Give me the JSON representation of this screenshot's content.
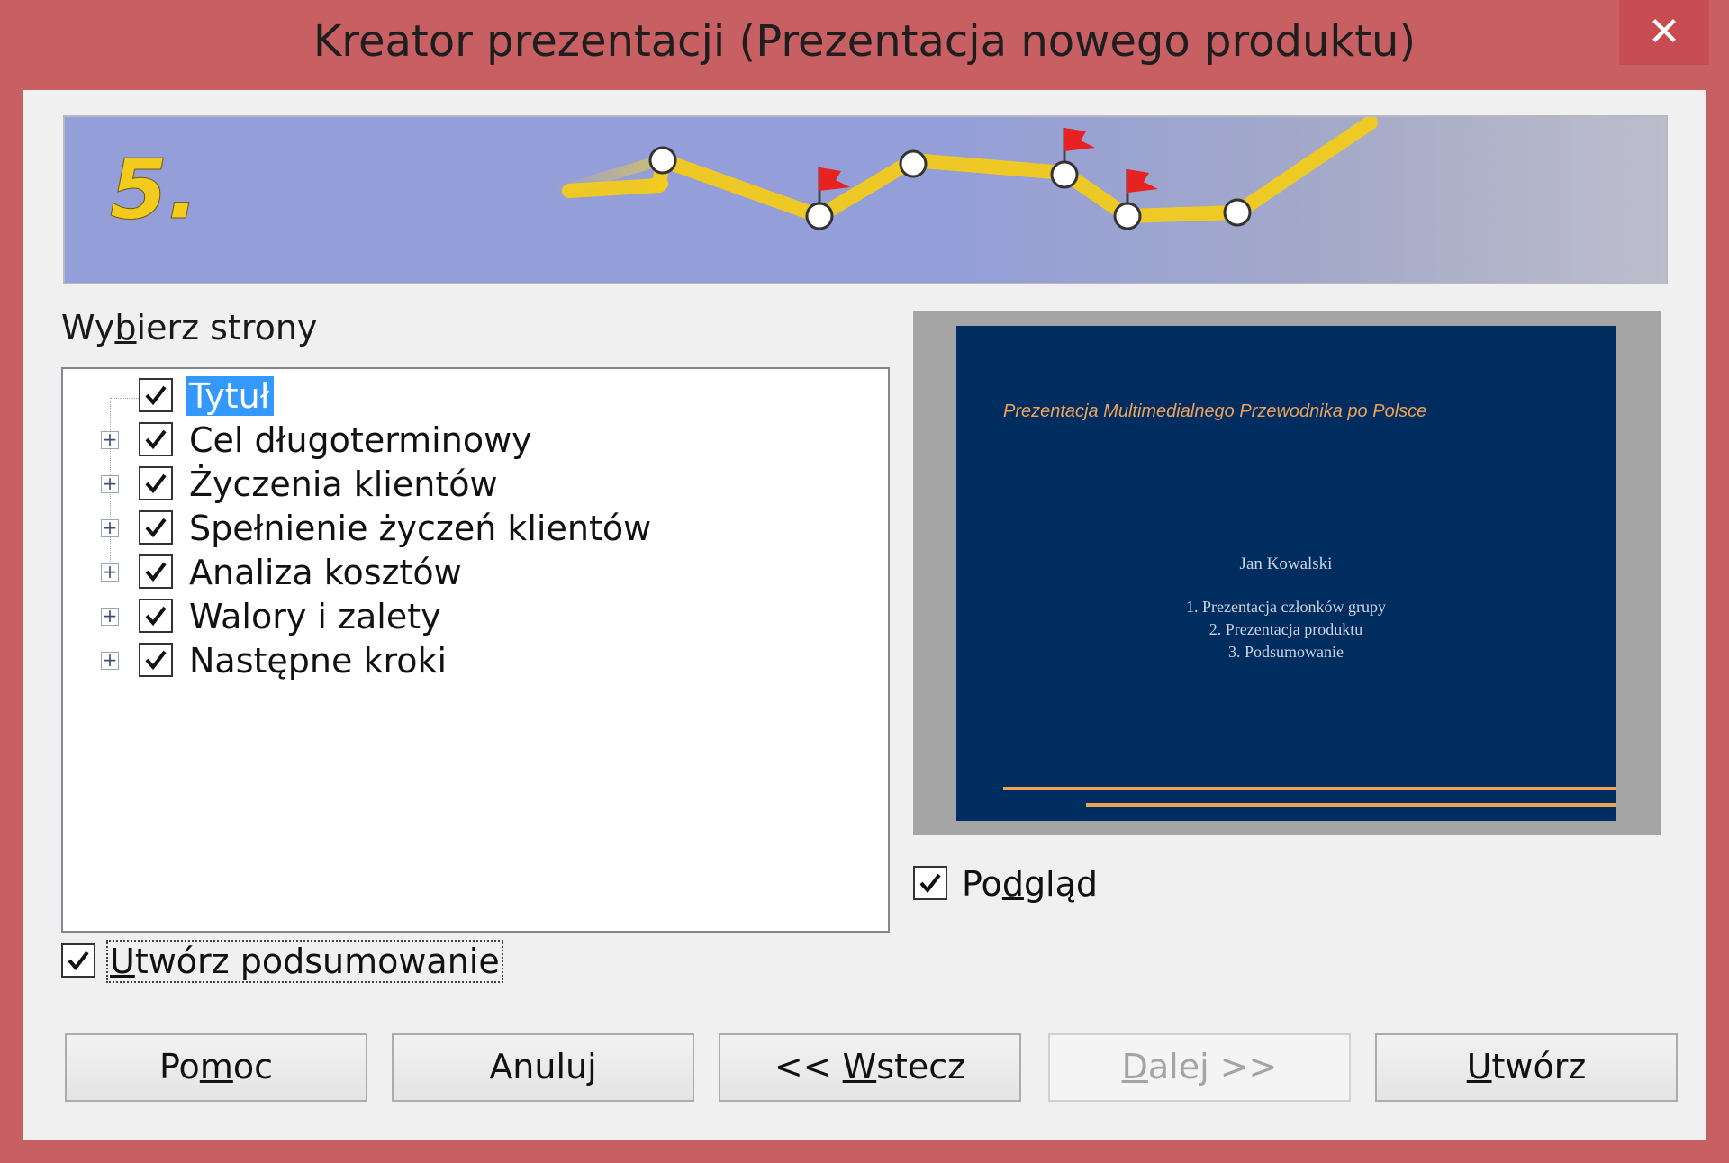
{
  "window": {
    "title": "Kreator prezentacji (Prezentacja nowego produktu)",
    "close_glyph": "✕"
  },
  "banner": {
    "step": "5."
  },
  "pages": {
    "label_pre": "Wy",
    "label_access": "b",
    "label_post": "ierz strony",
    "items": [
      {
        "label": "Tytuł",
        "checked": true,
        "expandable": false,
        "selected": true
      },
      {
        "label": "Cel długoterminowy",
        "checked": true,
        "expandable": true
      },
      {
        "label": "Życzenia klientów",
        "checked": true,
        "expandable": true
      },
      {
        "label": "Spełnienie życzeń klientów",
        "checked": true,
        "expandable": true
      },
      {
        "label": "Analiza kosztów",
        "checked": true,
        "expandable": true
      },
      {
        "label": "Walory i zalety",
        "checked": true,
        "expandable": true
      },
      {
        "label": "Następne kroki",
        "checked": true,
        "expandable": true
      }
    ]
  },
  "preview": {
    "slide_title": "Prezentacja Multimedialnego Przewodnika po Polsce",
    "author": "Jan Kowalski",
    "items": [
      "1. Prezentacja członków grupy",
      "2. Prezentacja produktu",
      "3. Podsumowanie"
    ],
    "checkbox_pre": "Po",
    "checkbox_access": "d",
    "checkbox_post": "gląd",
    "checked": true
  },
  "summary": {
    "access": "U",
    "rest": "twórz podsumowanie",
    "checked": true
  },
  "buttons": {
    "help_pre": "Po",
    "help_access": "m",
    "help_post": "oc",
    "cancel": "Anuluj",
    "back_pre": "<< ",
    "back_access": "W",
    "back_post": "stecz",
    "next_access": "D",
    "next_post": "alej >>",
    "create_access": "U",
    "create_post": "twórz",
    "next_disabled": true
  }
}
